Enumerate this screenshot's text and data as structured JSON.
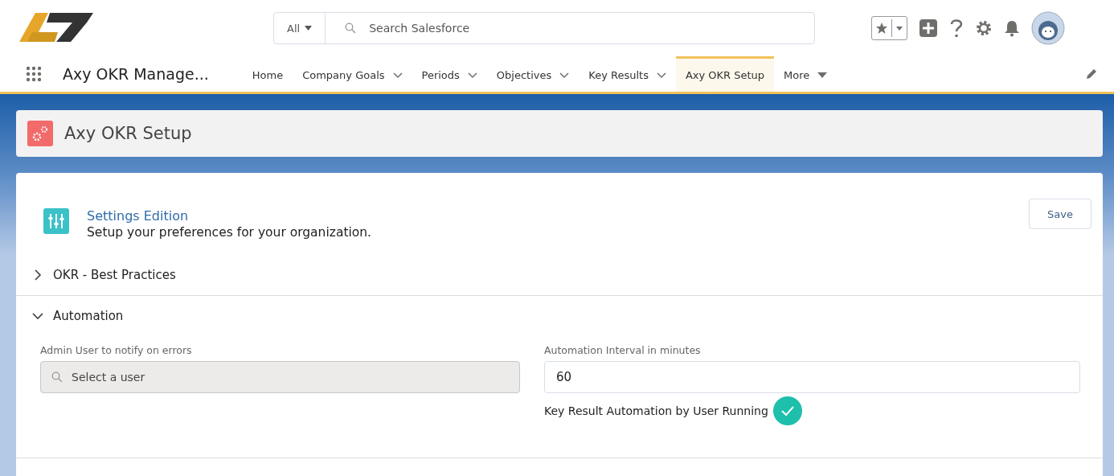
{
  "search": {
    "scope": "All",
    "placeholder": "Search Salesforce"
  },
  "app_name": "Axy OKR Manage...",
  "nav": [
    {
      "label": "Home",
      "kind": "plain",
      "selected": false
    },
    {
      "label": "Company Goals",
      "kind": "dropdown",
      "selected": false
    },
    {
      "label": "Periods",
      "kind": "dropdown",
      "selected": false
    },
    {
      "label": "Objectives",
      "kind": "dropdown",
      "selected": false
    },
    {
      "label": "Key Results",
      "kind": "dropdown",
      "selected": false
    },
    {
      "label": "Axy OKR Setup",
      "kind": "plain",
      "selected": true
    },
    {
      "label": "More",
      "kind": "more",
      "selected": false
    }
  ],
  "page_title": "Axy OKR Setup",
  "settings": {
    "title": "Settings Edition",
    "subtitle": "Setup your preferences for your organization.",
    "save": "Save"
  },
  "sections": [
    {
      "title": "OKR - Best Practices",
      "expanded": false
    },
    {
      "title": "Automation",
      "expanded": true
    }
  ],
  "automation": {
    "admin_label": "Admin User to notify on errors",
    "admin_placeholder": "Select a user",
    "interval_label": "Automation Interval in minutes",
    "interval_value": "60",
    "running_label": "Key Result Automation by User Running",
    "running_checked": true
  }
}
